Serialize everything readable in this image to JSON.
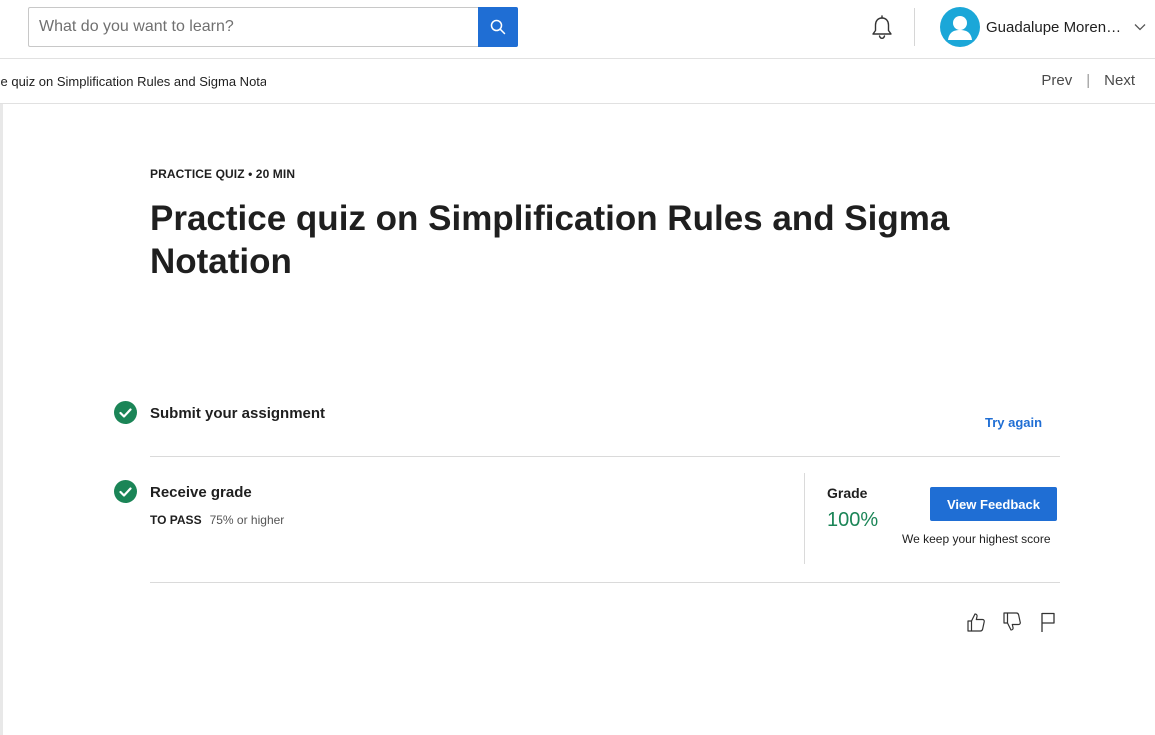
{
  "header": {
    "search": {
      "placeholder": "What do you want to learn?",
      "value": ""
    },
    "user": {
      "name": "Guadalupe Moreno..."
    }
  },
  "breadcrumb": {
    "text": "ce quiz on Simplification Rules and Sigma Notati",
    "prev_label": "Prev",
    "separator": "|",
    "next_label": "Next"
  },
  "main": {
    "eyebrow": "PRACTICE QUIZ • 20 MIN",
    "title": "Practice quiz on Simplification Rules and Sigma Notation",
    "steps": {
      "submit": {
        "label": "Submit your assignment",
        "action_label": "Try again"
      },
      "grade": {
        "label": "Receive grade",
        "to_pass_label": "TO PASS",
        "to_pass_value": "75% or higher",
        "grade_label": "Grade",
        "grade_value": "100%",
        "feedback_button": "View Feedback",
        "note": "We keep your highest score"
      }
    }
  },
  "colors": {
    "accent_blue": "#1f6ed4",
    "success_green": "#1b8557",
    "avatar_blue": "#1ba7d8"
  },
  "icons": [
    "search-icon",
    "bell-icon",
    "avatar-icon",
    "chevron-down-icon",
    "check-icon",
    "thumbs-up-icon",
    "thumbs-down-icon",
    "flag-icon"
  ]
}
